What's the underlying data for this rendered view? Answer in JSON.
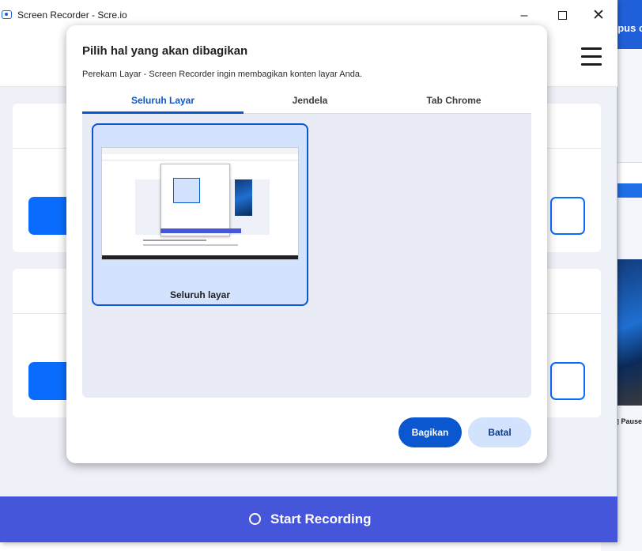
{
  "background_window": {
    "header_text": "apus c",
    "pause_label": "Pause"
  },
  "window": {
    "title": "Screen Recorder - Scre.io",
    "controls": {
      "minimize": "–",
      "maximize": "",
      "close": "✕"
    }
  },
  "main": {
    "start_button_label": "Start Recording"
  },
  "dialog": {
    "title": "Pilih hal yang akan dibagikan",
    "subtitle": "Perekam Layar - Screen Recorder ingin membagikan konten layar Anda.",
    "tabs": [
      {
        "label": "Seluruh Layar",
        "selected": true
      },
      {
        "label": "Jendela",
        "selected": false
      },
      {
        "label": "Tab Chrome",
        "selected": false
      }
    ],
    "screens": [
      {
        "label": "Seluruh layar",
        "selected": true
      }
    ],
    "share_button": "Bagikan",
    "cancel_button": "Batal"
  },
  "colors": {
    "accent": "#0b57d0",
    "start_bar": "#4556db",
    "primary_button": "#0a6cff"
  },
  "icons": {
    "app": "screen-recorder-icon",
    "menu": "hamburger-menu-icon",
    "record": "record-circle-icon"
  }
}
